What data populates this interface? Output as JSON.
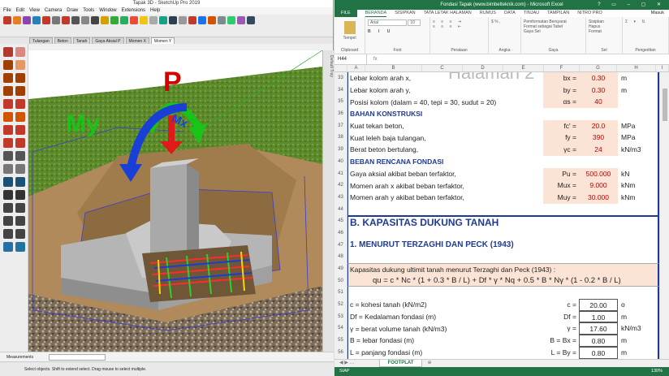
{
  "sketchup": {
    "title": "Tapak 3D - SketchUp Pro 2019",
    "menu": [
      "File",
      "Edit",
      "View",
      "Camera",
      "Draw",
      "Tools",
      "Window",
      "Extensions",
      "Help"
    ],
    "scenes": [
      "Tulangan",
      "Beton",
      "Tanah",
      "Gaya Aksial P",
      "Momen X",
      "Momen Y"
    ],
    "active_scene": "Momen Y",
    "labels": {
      "P": "P",
      "Mx": "Mx",
      "My": "My"
    },
    "tray_label": "Default Tray",
    "measurements_label": "Measurements",
    "status": "Select objects. Shift to extend select. Drag mouse to select multiple.",
    "colors": {
      "P": "#d40000",
      "Mx": "#1a3fd6",
      "My": "#19c419",
      "grass": "#5d8a2c",
      "soil": "#b08a5a",
      "concrete": "#bdbdbd"
    }
  },
  "excel": {
    "title": "Fondasi Tapak (www.bimbelteknik.com) - Microsoft Excel",
    "user": "Masuk",
    "tabs": [
      "FILE",
      "BERANDA",
      "SISIPKAN",
      "TATA LETAK HALAMAN",
      "RUMUS",
      "DATA",
      "TINJAU",
      "TAMPILAN",
      "NITRO PRO"
    ],
    "active_tab": "BERANDA",
    "ribbon": {
      "clipboard": "Clipboard",
      "paste": "Tempel",
      "font": "Font",
      "font_name": "Arial",
      "font_size": "10",
      "alignment": "Perataan",
      "number": "Angka",
      "styles": "Gaya",
      "cond_format": "Pemformatan Bersyarat",
      "table_format": "Format sebagai Tabel",
      "cell_style": "Gaya Sel",
      "cells": "Sel",
      "insert": "Sisipkan",
      "delete": "Hapus",
      "format": "Format",
      "editing": "Pengeditan"
    },
    "name_box": "H44",
    "fx": "fx",
    "columns": [
      "A",
      "B",
      "C",
      "D",
      "E",
      "F",
      "G",
      "H",
      "I"
    ],
    "watermark": "Halaman 2",
    "rows": [
      {
        "n": "33",
        "desc": "Lebar kolom arah x,",
        "sym": "bx =",
        "val": "0.30",
        "unit": "m"
      },
      {
        "n": "34",
        "desc": "Lebar kolom arah y,",
        "sym": "by =",
        "val": "0.30",
        "unit": "m"
      },
      {
        "n": "35",
        "desc": "Posisi kolom (dalam = 40, tepi = 30, sudut = 20)",
        "sym": "αs =",
        "val": "40",
        "unit": ""
      },
      {
        "n": "36",
        "desc": "BAHAN KONSTRUKSI",
        "section": true
      },
      {
        "n": "37",
        "desc": "Kuat tekan beton,",
        "sym": "fc' =",
        "val": "20.0",
        "unit": "MPa"
      },
      {
        "n": "38",
        "desc": "Kuat leleh baja tulangan,",
        "sym": "fy =",
        "val": "390",
        "unit": "MPa"
      },
      {
        "n": "39",
        "desc": "Berat beton bertulang,",
        "sym": "γc =",
        "val": "24",
        "unit": "kN/m3"
      },
      {
        "n": "40",
        "desc": "BEBAN RENCANA FONDASI",
        "section": true
      },
      {
        "n": "41",
        "desc": "Gaya aksial akibat beban terfaktor,",
        "sym": "Pu =",
        "val": "500.000",
        "unit": "kN"
      },
      {
        "n": "42",
        "desc": "Momen arah x akibat beban terfaktor,",
        "sym": "Mux =",
        "val": "9.000",
        "unit": "kNm"
      },
      {
        "n": "43",
        "desc": "Momen arah y akibat beban terfaktor,",
        "sym": "Muy =",
        "val": "30.000",
        "unit": "kNm"
      },
      {
        "n": "44",
        "desc": ""
      },
      {
        "n": "45",
        "desc": "B. KAPASITAS DUKUNG TANAH",
        "big": true
      },
      {
        "n": "46",
        "desc": ""
      },
      {
        "n": "47",
        "desc": "1. MENURUT TERZAGHI DAN PECK (1943)",
        "mid": true
      },
      {
        "n": "48",
        "desc": ""
      },
      {
        "n": "49",
        "desc": "Kapasitas dukung ultimit tanah menurut Terzaghi dan Peck (1943) :",
        "box": true
      },
      {
        "n": "50",
        "desc": "qu = c * Nc * (1 + 0.3 * B / L) + Df * γ * Nq + 0.5 * B * Nγ * (1 - 0.2 * B / L)",
        "formula": true
      },
      {
        "n": "51",
        "desc": ""
      },
      {
        "n": "52",
        "desc": "c = kohesi tanah (kN/m2)",
        "sym": "c =",
        "val": "20.00",
        "unit": "o"
      },
      {
        "n": "53",
        "desc": "Df = Kedalaman fondasi (m)",
        "sym": "Df =",
        "val": "1.00",
        "unit": "m"
      },
      {
        "n": "54",
        "desc": "γ = berat volume tanah (kN/m3)",
        "sym": "γ =",
        "val": "17.60",
        "unit": "kN/m3"
      },
      {
        "n": "55",
        "desc": "B = lebar fondasi (m)",
        "sym": "B = Bx =",
        "val": "0.80",
        "unit": "m"
      },
      {
        "n": "56",
        "desc": "L = panjang fondasi (m)",
        "sym": "L = By =",
        "val": "0.80",
        "unit": "m"
      }
    ],
    "sheet": "FOOTPLAT",
    "status": "SIAP",
    "zoom": "130%"
  }
}
